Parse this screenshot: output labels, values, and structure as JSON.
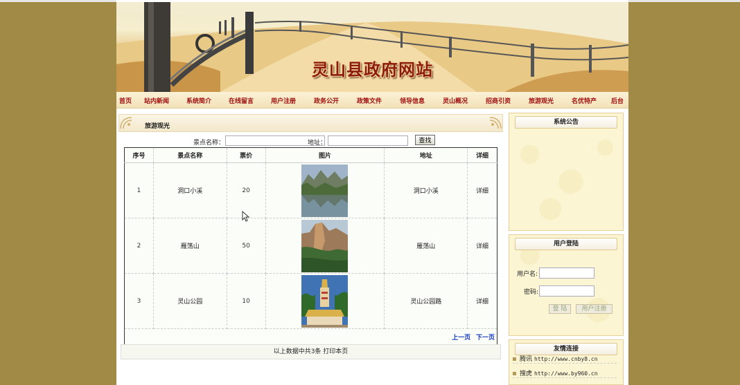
{
  "site": {
    "title": "灵山县政府网站"
  },
  "nav": [
    "首页",
    "站内新闻",
    "系统简介",
    "在线留言",
    "用户注册",
    "政务公开",
    "政策文件",
    "领导信息",
    "灵山概况",
    "招商引资",
    "旅游观光",
    "名优特产",
    "后台"
  ],
  "section": {
    "title": "旅游观光"
  },
  "search": {
    "name_label": "景点名称：",
    "address_label": "地址：",
    "name_value": "",
    "address_value": "",
    "button": "查找"
  },
  "table": {
    "headers": [
      "序号",
      "景点名称",
      "票价",
      "图片",
      "地址",
      "详细"
    ],
    "rows": [
      {
        "no": "1",
        "name": "洞口小溪",
        "price": "20",
        "image": "river-valley-photo",
        "address": "洞口小溪",
        "detail": "详细"
      },
      {
        "no": "2",
        "name": "雁荡山",
        "price": "50",
        "image": "mountain-cliff-photo",
        "address": "雁荡山",
        "detail": "详细"
      },
      {
        "no": "3",
        "name": "灵山公园",
        "price": "10",
        "image": "temple-tower-photo",
        "address": "灵山公园路",
        "detail": "详细"
      }
    ],
    "prev": "上一页",
    "next": "下一页"
  },
  "footer_note": "以上数据中共3条  打印本页",
  "sidebar": {
    "notice_title": "系统公告",
    "login_title": "用户登陆",
    "username_label": "用户名:",
    "password_label": "密码:",
    "login_button": "登 陆",
    "register_button": "用户注册",
    "links_title": "友情连接",
    "links": [
      {
        "name": "腾讯",
        "url": "http://www.cnby8.cn"
      },
      {
        "name": "搜虎",
        "url": "http://www.by960.cn"
      }
    ]
  },
  "colors": {
    "background": "#a08a45",
    "nav_text": "#a01010",
    "title": "#8b1a0f",
    "pager": "#1a3cc0"
  }
}
